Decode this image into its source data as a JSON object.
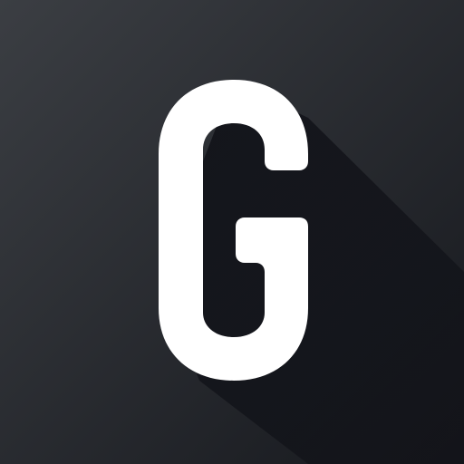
{
  "icon": {
    "letter": "G",
    "colors": {
      "background_top_left": "#3b3e43",
      "background_bottom_right": "#16181d",
      "long_shadow": "#121319",
      "glyph": "#ffffff"
    }
  }
}
